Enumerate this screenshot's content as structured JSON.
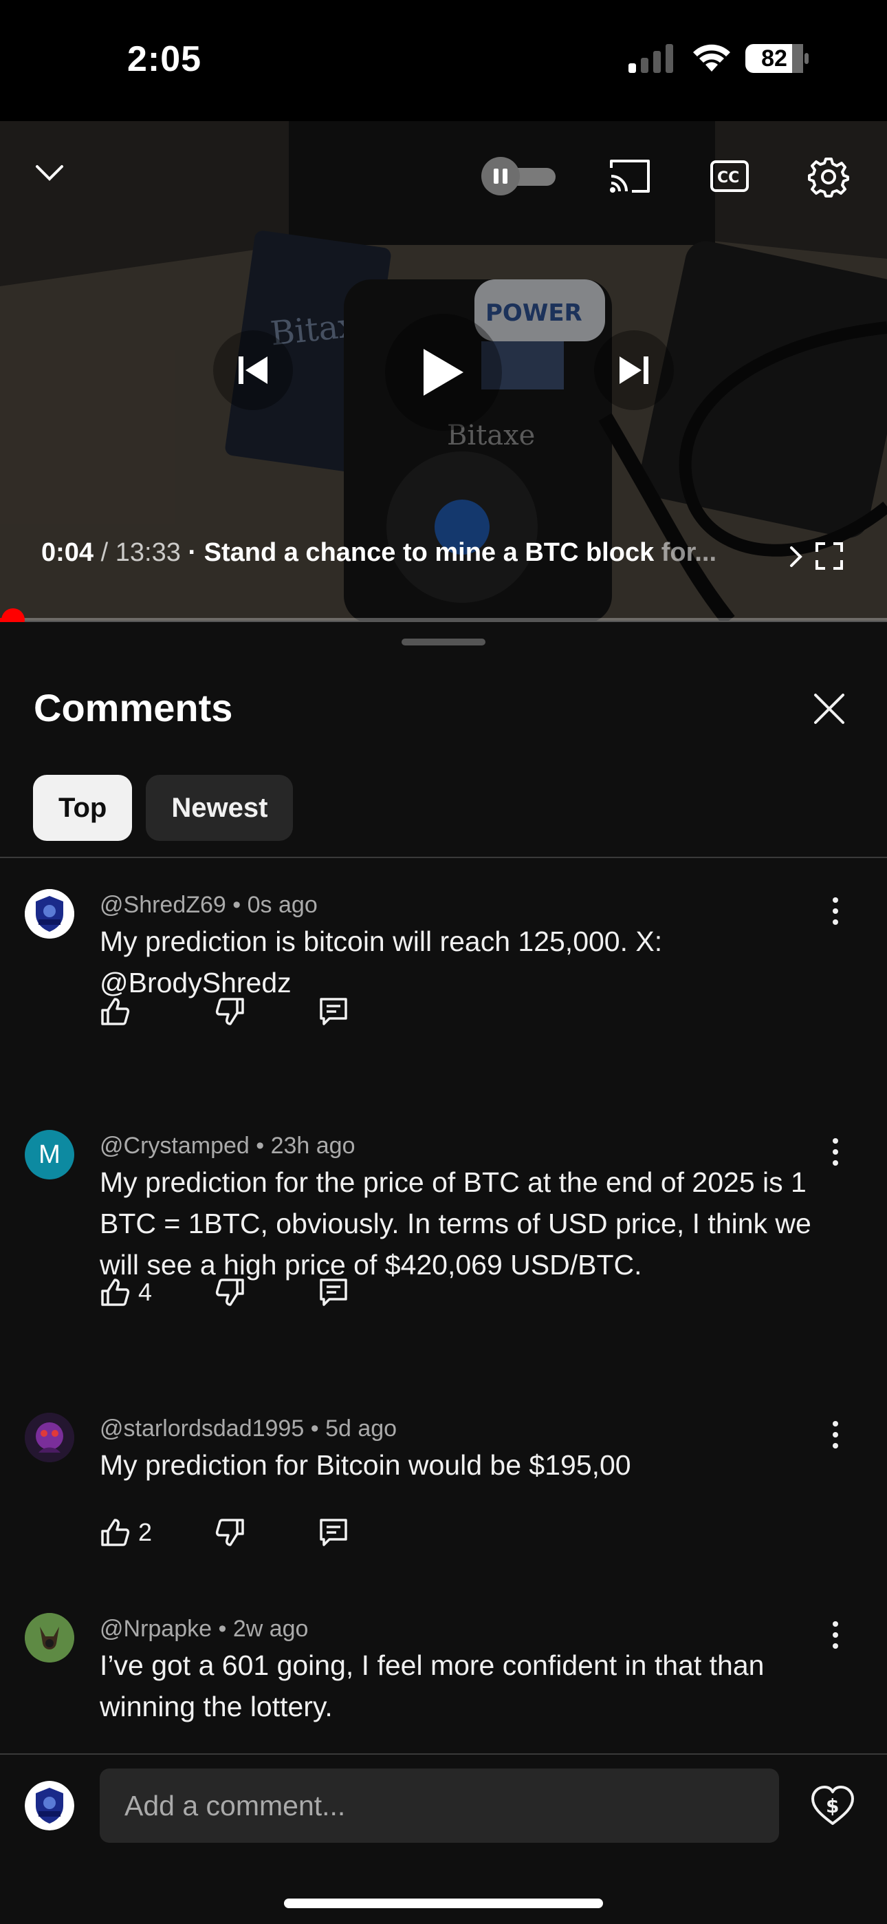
{
  "status_bar": {
    "time": "2:05",
    "battery": "82"
  },
  "player": {
    "time_current": "0:04",
    "time_separator": " / ",
    "time_total": "13:33",
    "dot": " · ",
    "title_visible": "Stand a chance to mine a BTC block ",
    "title_faded": "for...",
    "progress_fraction": 0.005,
    "accent_color": "#ff0000"
  },
  "comments_panel": {
    "title": "Comments",
    "sort_chips": [
      {
        "label": "Top",
        "active": true
      },
      {
        "label": "Newest",
        "active": false
      }
    ]
  },
  "comments": [
    {
      "author": "@ShredZ69",
      "time": "0s ago",
      "text": "My prediction is bitcoin will reach 125,000. X: @BrodyShredz",
      "likes": "",
      "avatar_icon": "shield-logo-avatar"
    },
    {
      "author": "@Crystamped",
      "time": "23h ago",
      "text": "My prediction for the price of BTC at the end of 2025 is 1 BTC = 1BTC, obviously.  In terms of USD price, I think we will see a high price of $420,069 USD/BTC.",
      "likes": "4",
      "avatar_letter": "M",
      "avatar_color": "#0d8aa1"
    },
    {
      "author": "@starlordsdad1995",
      "time": "5d ago",
      "text": "My prediction for Bitcoin would be $195,00",
      "likes": "2",
      "avatar_icon": "purple-character-avatar"
    },
    {
      "author": "@Nrpapke",
      "time": "2w ago",
      "text": "I’ve got a 601 going, I feel more confident in that than winning the lottery.",
      "likes": "",
      "avatar_icon": "dog-photo-avatar"
    }
  ],
  "composer": {
    "placeholder": "Add a comment..."
  }
}
